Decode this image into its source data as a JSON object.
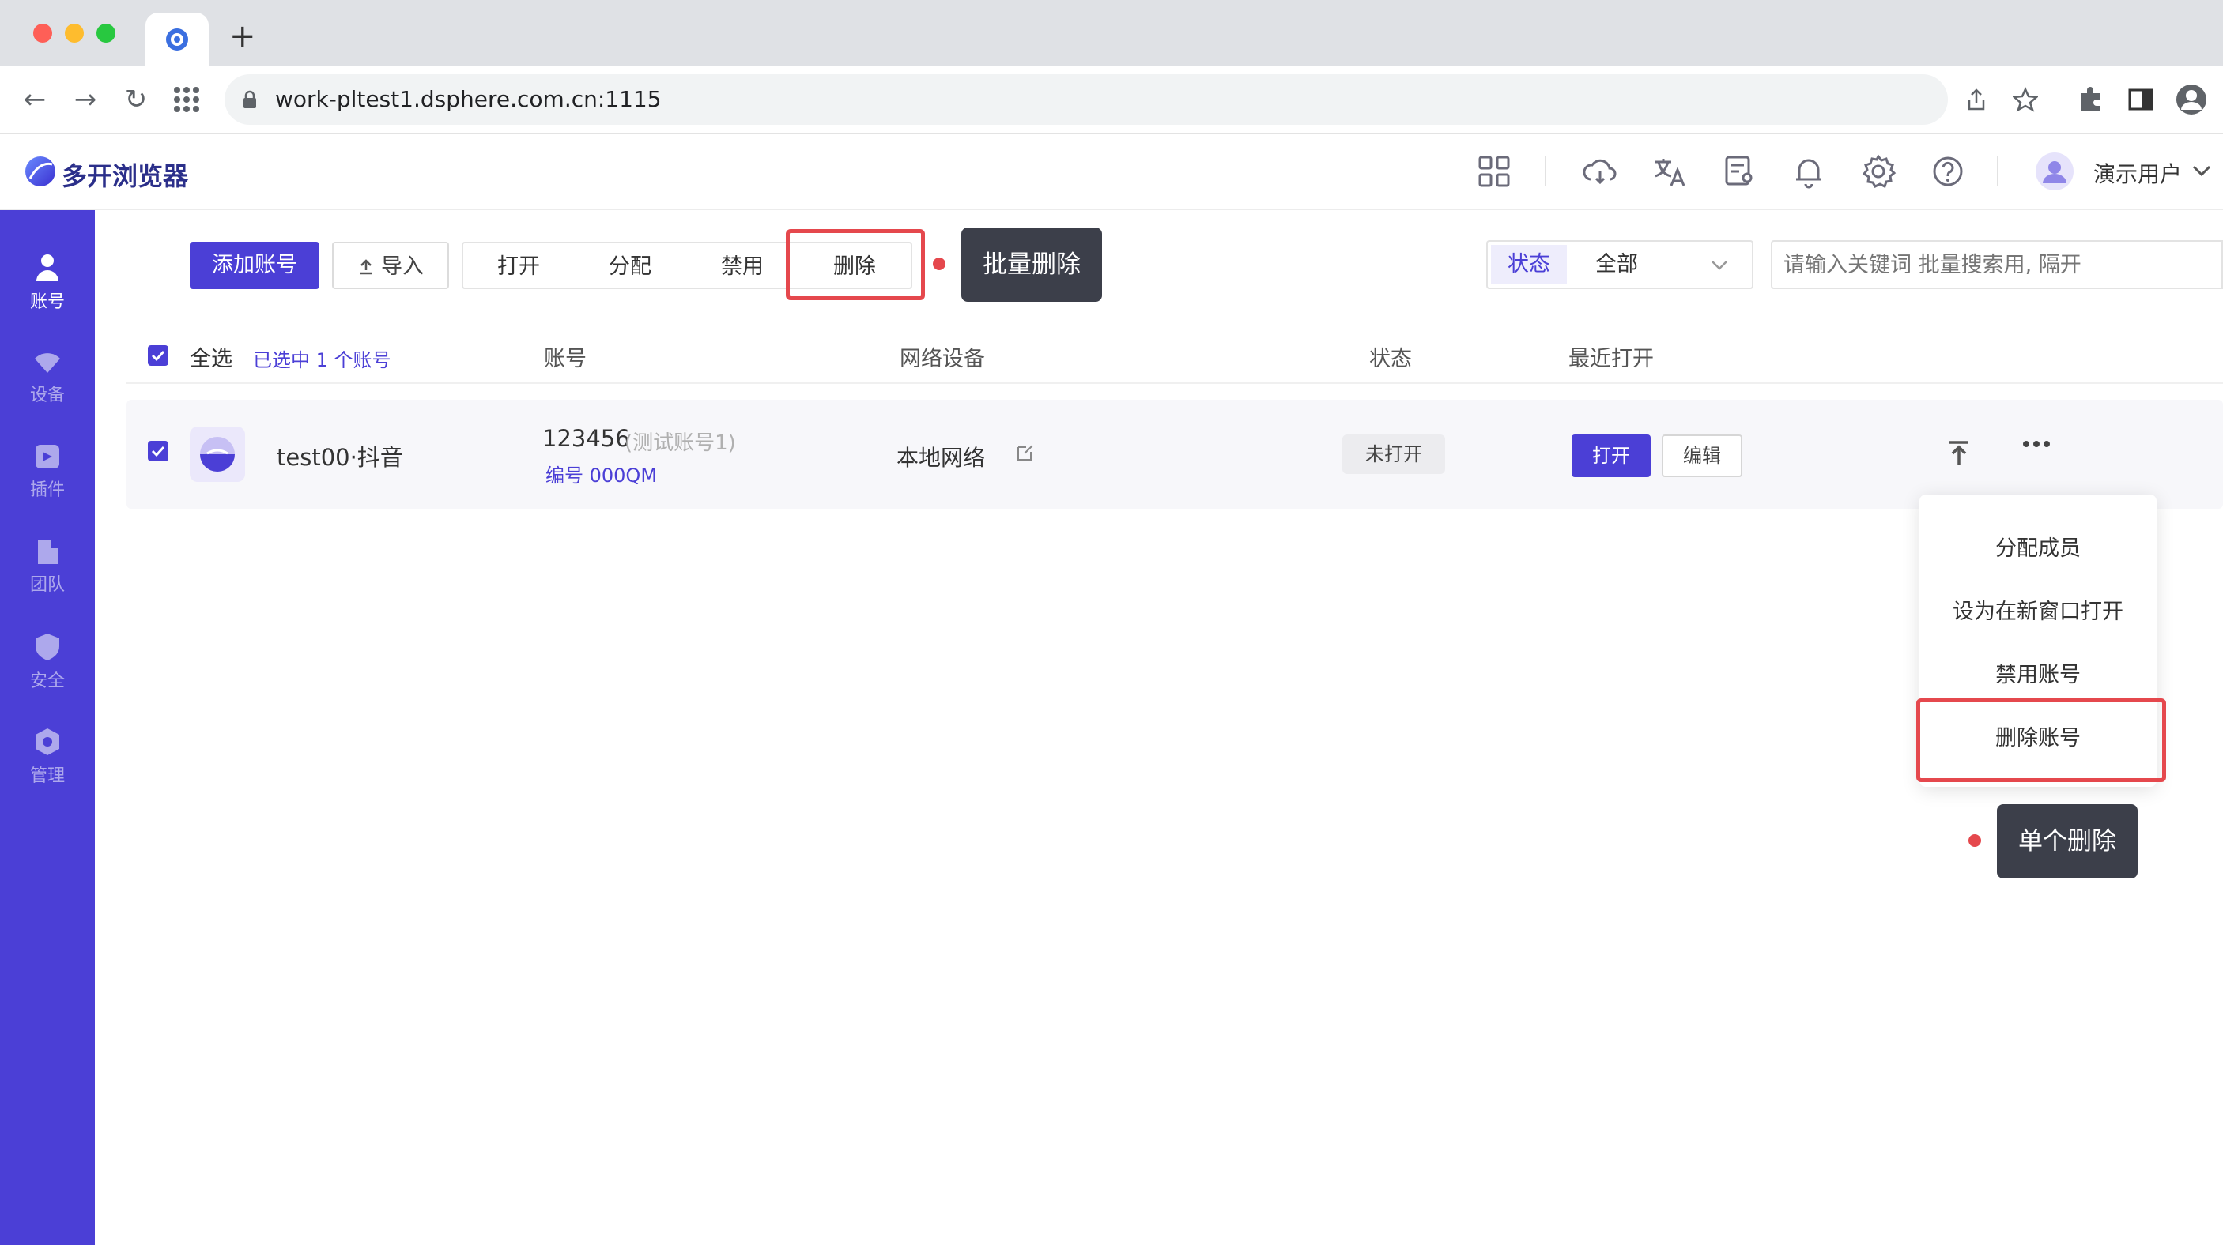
{
  "browser": {
    "url": "work-pltest1.dsphere.com.cn:1115",
    "new_tab": "+"
  },
  "app": {
    "brand": "多开浏览器",
    "user": "演示用户"
  },
  "sidebar": {
    "items": [
      {
        "label": "账号",
        "icon": "user-icon",
        "active": true
      },
      {
        "label": "设备",
        "icon": "wifi-icon",
        "active": false
      },
      {
        "label": "插件",
        "icon": "plugin-icon",
        "active": false
      },
      {
        "label": "团队",
        "icon": "building-icon",
        "active": false
      },
      {
        "label": "安全",
        "icon": "shield-icon",
        "active": false
      },
      {
        "label": "管理",
        "icon": "hexagon-icon",
        "active": false
      }
    ]
  },
  "toolbar": {
    "add_account": "添加账号",
    "import": "导入",
    "open": "打开",
    "assign": "分配",
    "disable": "禁用",
    "delete": "删除",
    "batch_delete_tip": "批量删除",
    "status_label": "状态",
    "status_value": "全部",
    "search_placeholder": "请输入关键词 批量搜索用, 隔开"
  },
  "table": {
    "select_all": "全选",
    "selected_info": "已选中 1 个账号",
    "headers": {
      "account": "账号",
      "network": "网络设备",
      "status": "状态",
      "recent": "最近打开"
    },
    "rows": [
      {
        "name": "test00·抖音",
        "account_id": "123456",
        "account_note": "(测试账号1)",
        "serial": "编号 000QM",
        "network": "本地网络",
        "status": "未打开",
        "open_btn": "打开",
        "edit_btn": "编辑"
      }
    ]
  },
  "menu": {
    "items": [
      "分配成员",
      "设为在新窗口打开",
      "禁用账号",
      "删除账号"
    ],
    "single_delete_tip": "单个删除"
  },
  "colors": {
    "brand": "#4b3fd6",
    "highlight": "#e5484d"
  }
}
